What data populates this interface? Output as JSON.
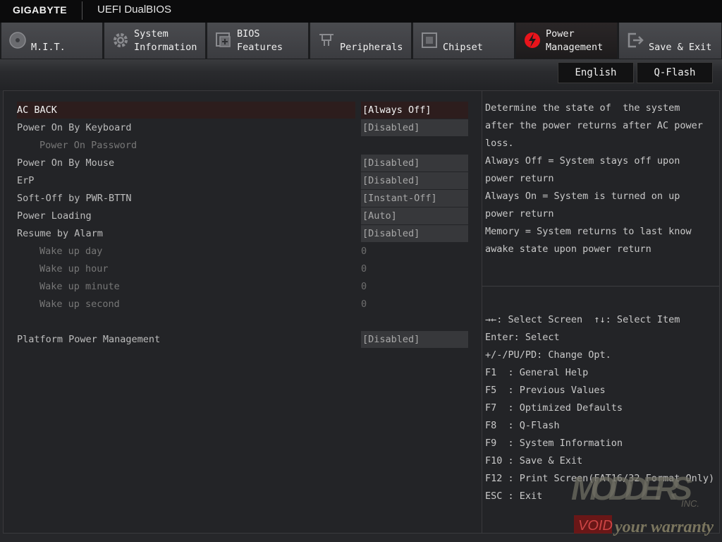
{
  "header": {
    "brand": "GIGABYTE",
    "product": "UEFI DualBIOS"
  },
  "tabs": [
    {
      "label": "M.I.T.",
      "icon": "gauge-icon",
      "active": false
    },
    {
      "label": "System\nInformation",
      "icon": "gear-icon",
      "active": false
    },
    {
      "label": "BIOS\nFeatures",
      "icon": "chip-add-icon",
      "active": false
    },
    {
      "label": "Peripherals",
      "icon": "connector-icon",
      "active": false
    },
    {
      "label": "Chipset",
      "icon": "chipset-icon",
      "active": false
    },
    {
      "label": "Power\nManagement",
      "icon": "lightning-icon",
      "active": true
    },
    {
      "label": "Save & Exit",
      "icon": "exit-icon",
      "active": false
    }
  ],
  "toolbar": {
    "language": "English",
    "qflash": "Q-Flash"
  },
  "settings": [
    {
      "label": "AC BACK",
      "value": "[Always Off]",
      "selected": true
    },
    {
      "label": "Power On By Keyboard",
      "value": "[Disabled]"
    },
    {
      "label": "Power On Password",
      "value": ""
    },
    {
      "label": "Power On By Mouse",
      "value": "[Disabled]"
    },
    {
      "label": "ErP",
      "value": "[Disabled]"
    },
    {
      "label": "Soft-Off by PWR-BTTN",
      "value": "[Instant-Off]"
    },
    {
      "label": "Power Loading",
      "value": "[Auto]"
    },
    {
      "label": "Resume by Alarm",
      "value": "[Disabled]"
    },
    {
      "label": "Wake up day",
      "value": "0"
    },
    {
      "label": "Wake up hour",
      "value": "0"
    },
    {
      "label": "Wake up minute",
      "value": "0"
    },
    {
      "label": "Wake up second",
      "value": "0"
    },
    {
      "label": "Platform Power Management",
      "value": "[Disabled]"
    }
  ],
  "help": {
    "description": [
      "Determine the state of  the system",
      "after the power returns after AC power",
      "loss.",
      "Always Off = System stays off upon",
      "power return",
      "Always On = System is turned on up",
      "power return",
      "Memory = System returns to last know",
      "awake state upon power return"
    ],
    "keys": [
      "→←: Select Screen  ↑↓: Select Item",
      "Enter: Select",
      "+/-/PU/PD: Change Opt.",
      "F1  : General Help",
      "F5  : Previous Values",
      "F7  : Optimized Defaults",
      "F8  : Q-Flash",
      "F9  : System Information",
      "F10 : Save & Exit",
      "F12 : Print Screen(FAT16/32 Format Only)",
      "ESC : Exit"
    ]
  },
  "watermark": {
    "line1": "MODDERS",
    "line2": "INC.",
    "line3": "VOID",
    "line4": "your warranty"
  },
  "colors": {
    "accent": "#e8141b",
    "selected_bg": "#2d1d1d"
  }
}
